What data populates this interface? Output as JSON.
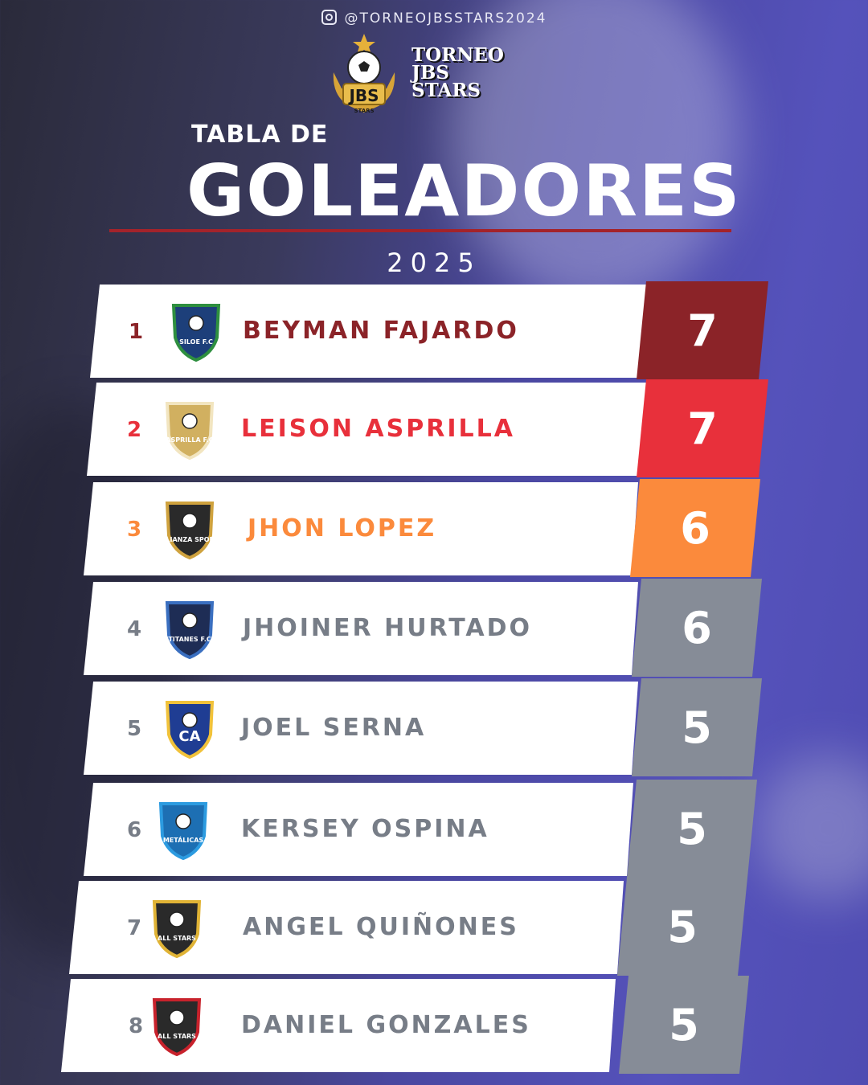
{
  "header": {
    "handle": "@TORNEOJBSSTARS2024",
    "brand_line1": "TORNEO",
    "brand_line2": "JBS",
    "brand_line3": "STARS",
    "logo_text": "JBS",
    "logo_sub": "STARS",
    "subtitle": "TABLA DE",
    "title": "GOLEADORES",
    "year": "2025"
  },
  "colors": {
    "rank1": "#8b2328",
    "rank2": "#e8303b",
    "rank3": "#fb8a3c",
    "others": "#868c97",
    "name_gray": "#777d87"
  },
  "scorers": [
    {
      "rank": "1",
      "name": "BEYMAN FAJARDO",
      "goals": "7",
      "crest_text": "SILOE F.C",
      "crest_icon": "siloe-fc-crest-icon"
    },
    {
      "rank": "2",
      "name": "LEISON ASPRILLA",
      "goals": "7",
      "crest_text": "ASPRILLA F.C",
      "crest_icon": "asprilla-fc-crest-icon"
    },
    {
      "rank": "3",
      "name": "JHON LOPEZ",
      "goals": "6",
      "crest_text": "ALIANZA SPORT",
      "crest_icon": "alianza-sport-crest-icon"
    },
    {
      "rank": "4",
      "name": "JHOINER HURTADO",
      "goals": "6",
      "crest_text": "TITANES F.C",
      "crest_icon": "titanes-fc-crest-icon"
    },
    {
      "rank": "5",
      "name": "JOEL SERNA",
      "goals": "5",
      "crest_text": "CA",
      "crest_icon": "combo-del-ayer-crest-icon"
    },
    {
      "rank": "6",
      "name": "KERSEY OSPINA",
      "goals": "5",
      "crest_text": "METÁLICAS",
      "crest_icon": "metalicas-crest-icon"
    },
    {
      "rank": "7",
      "name": "ANGEL QUIÑONES",
      "goals": "5",
      "crest_text": "ALL STARS",
      "crest_icon": "all-stars-gold-crest-icon"
    },
    {
      "rank": "8",
      "name": "DANIEL GONZALES",
      "goals": "5",
      "crest_text": "ALL STARS",
      "crest_icon": "all-stars-red-crest-icon"
    }
  ]
}
